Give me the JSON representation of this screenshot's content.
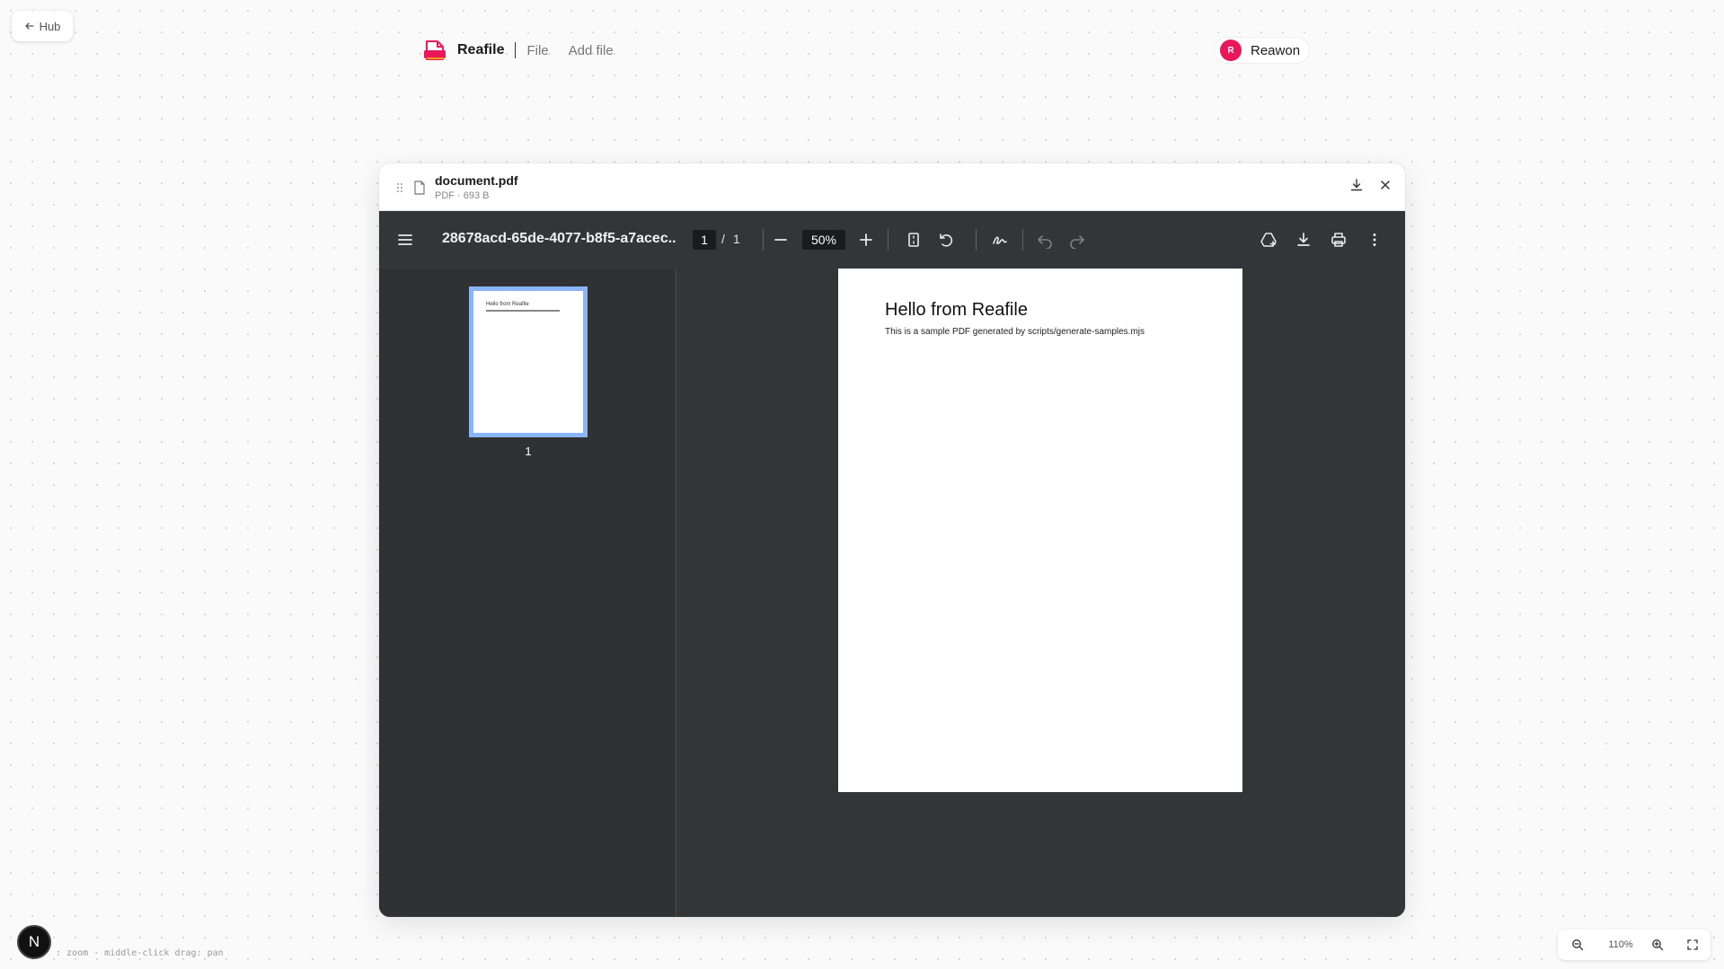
{
  "hub": {
    "label": "Hub"
  },
  "topbar": {
    "brand": "Reafile",
    "menu": [
      "File",
      "Add file"
    ],
    "brand_color": "#e8185a"
  },
  "user": {
    "initial": "R",
    "name": "Reawon",
    "avatar_color": "#e8185a"
  },
  "window": {
    "file_name": "document.pdf",
    "file_meta": "PDF · 693 B"
  },
  "viewer": {
    "title": "28678acd-65de-4077-b8f5-a7acec...",
    "page_current": "1",
    "page_sep": "/",
    "page_total": "1",
    "zoom": "50%",
    "thumbnail_label": "1",
    "thumb_title": "Hello from Reafile",
    "page_heading": "Hello from Reafile",
    "page_body": "This is a sample PDF generated by scripts/generate-samples.mjs",
    "accent_color": "#8ab4f8"
  },
  "footer": {
    "badge": "N",
    "hint": ": zoom · middle-click drag: pan"
  },
  "canvas_zoom": {
    "label": "110%"
  }
}
